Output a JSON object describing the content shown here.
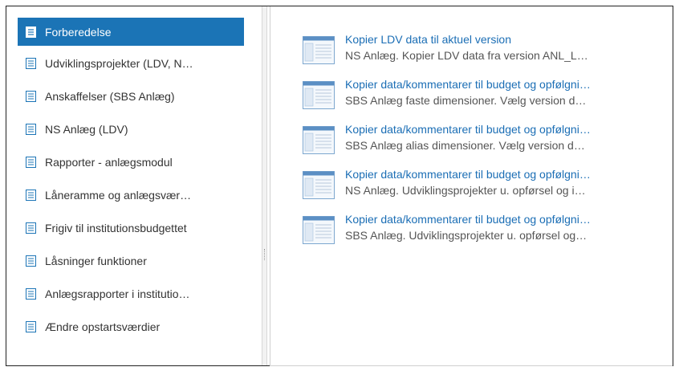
{
  "sidebar": {
    "items": [
      {
        "label": "Forberedelse",
        "active": true,
        "icon": "document-icon"
      },
      {
        "label": "Udviklingsprojekter (LDV, N…",
        "active": false,
        "icon": "document-icon"
      },
      {
        "label": "Anskaffelser (SBS Anlæg)",
        "active": false,
        "icon": "document-icon"
      },
      {
        "label": "NS Anlæg (LDV)",
        "active": false,
        "icon": "document-icon"
      },
      {
        "label": "Rapporter - anlægsmodul",
        "active": false,
        "icon": "document-icon"
      },
      {
        "label": "Låneramme og anlægsvær…",
        "active": false,
        "icon": "document-icon"
      },
      {
        "label": "Frigiv til institutionsbudgettet",
        "active": false,
        "icon": "document-icon"
      },
      {
        "label": "Låsninger funktioner",
        "active": false,
        "icon": "document-icon"
      },
      {
        "label": "Anlægsrapporter i institutio…",
        "active": false,
        "icon": "document-icon"
      },
      {
        "label": "Ændre opstartsværdier",
        "active": false,
        "icon": "document-icon"
      }
    ]
  },
  "main": {
    "tasks": [
      {
        "title": "Kopier LDV data til aktuel version",
        "description": "NS Anlæg. Kopier LDV data fra version ANL_L…",
        "icon": "form-icon"
      },
      {
        "title": "Kopier data/kommentarer til budget og opfølgni…",
        "description": "SBS Anlæg faste dimensioner. Vælg version d…",
        "icon": "form-icon"
      },
      {
        "title": "Kopier data/kommentarer til budget og opfølgni…",
        "description": "SBS Anlæg alias dimensioner. Vælg version d…",
        "icon": "form-icon"
      },
      {
        "title": "Kopier data/kommentarer til budget og opfølgni…",
        "description": "NS Anlæg. Udviklingsprojekter u. opførsel og i…",
        "icon": "form-icon"
      },
      {
        "title": "Kopier data/kommentarer til budget og opfølgni…",
        "description": "SBS Anlæg. Udviklingsprojekter u. opførsel og…",
        "icon": "form-icon"
      }
    ]
  },
  "colors": {
    "accent": "#1b74b6",
    "link": "#1b6eb5",
    "text": "#333333",
    "muted": "#555555"
  }
}
